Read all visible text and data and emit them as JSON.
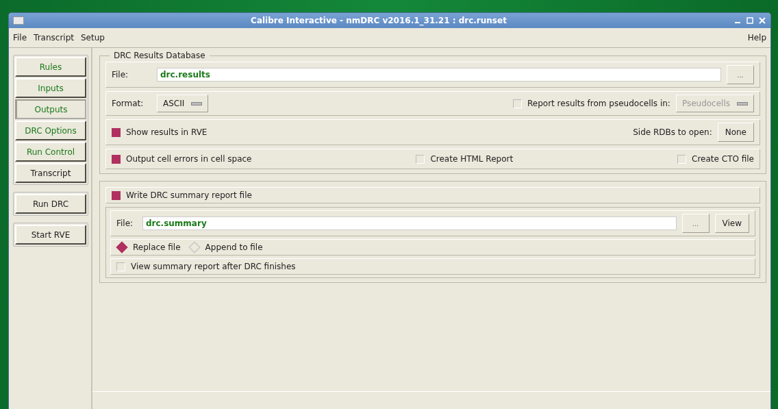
{
  "window": {
    "title": "Calibre Interactive - nmDRC v2016.1_31.21 : drc.runset"
  },
  "menu": [
    "File",
    "Transcript",
    "Setup"
  ],
  "help_menu": "Help",
  "sidebar": {
    "items": [
      {
        "label": "Rules",
        "selected": false,
        "color": "#1a7a1a"
      },
      {
        "label": "Inputs",
        "selected": false,
        "color": "#1a7a1a"
      },
      {
        "label": "Outputs",
        "selected": true,
        "color": "#1a7a1a"
      },
      {
        "label": "DRC Options",
        "selected": false,
        "color": "#1a7a1a"
      },
      {
        "label": "Run Control",
        "selected": false,
        "color": "#1a7a1a"
      },
      {
        "label": "Transcript",
        "selected": false,
        "color": "#1a1a1a"
      }
    ],
    "actions": [
      "Run DRC",
      "Start RVE"
    ]
  },
  "results_db": {
    "title": "DRC Results Database",
    "file_label": "File:",
    "file_value": "drc.results",
    "browse": "...",
    "format_label": "Format:",
    "format_value": "ASCII",
    "pseudocells": {
      "label": "Report results from pseudocells in:",
      "checked": false,
      "value": "Pseudocells"
    },
    "show_rve": {
      "label": "Show results in RVE",
      "checked": true
    },
    "side_rdbs_label": "Side RDBs to open:",
    "side_rdbs_value": "None",
    "cell_errors": {
      "label": "Output cell errors in cell space",
      "checked": true
    },
    "html_report": {
      "label": "Create HTML Report",
      "checked": false
    },
    "cto_file": {
      "label": "Create CTO file",
      "checked": false
    }
  },
  "summary": {
    "write": {
      "label": "Write DRC summary report file",
      "checked": true
    },
    "file_label": "File:",
    "file_value": "drc.summary",
    "browse": "...",
    "view": "View",
    "modes": [
      {
        "label": "Replace file",
        "selected": true
      },
      {
        "label": "Append to file",
        "selected": false
      }
    ],
    "view_after": {
      "label": "View summary report after DRC finishes",
      "checked": false
    }
  }
}
